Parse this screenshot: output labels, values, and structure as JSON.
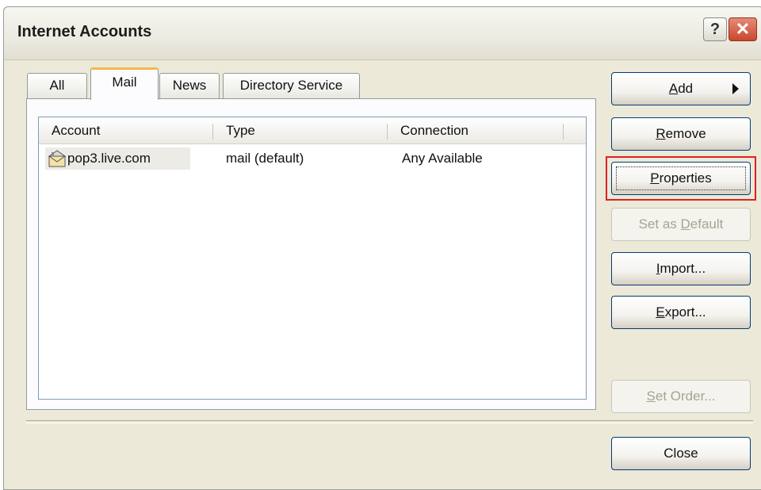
{
  "window": {
    "title": "Internet Accounts",
    "help_label": "?",
    "close_label": "✕"
  },
  "tabs": [
    {
      "label": "All"
    },
    {
      "label": "Mail"
    },
    {
      "label": "News"
    },
    {
      "label": "Directory Service"
    }
  ],
  "list": {
    "columns": [
      "Account",
      "Type",
      "Connection"
    ],
    "rows": [
      {
        "account": "pop3.live.com",
        "type": "mail (default)",
        "connection": "Any Available",
        "icon": "mail-account-icon"
      }
    ]
  },
  "buttons": {
    "add": {
      "mnemonic": "A",
      "rest": "dd"
    },
    "remove": {
      "mnemonic": "R",
      "rest": "emove"
    },
    "properties": {
      "mnemonic": "P",
      "rest": "roperties"
    },
    "set_default": {
      "pre": "Set as ",
      "mnemonic": "D",
      "rest": "efault"
    },
    "import": {
      "mnemonic": "I",
      "rest": "mport..."
    },
    "export": {
      "mnemonic": "E",
      "rest": "xport..."
    },
    "set_order": {
      "mnemonic": "S",
      "rest": "et Order..."
    },
    "close": {
      "label": "Close"
    }
  },
  "colors": {
    "highlight": "#e02020",
    "active_tab_accent": "#f5b84a"
  }
}
